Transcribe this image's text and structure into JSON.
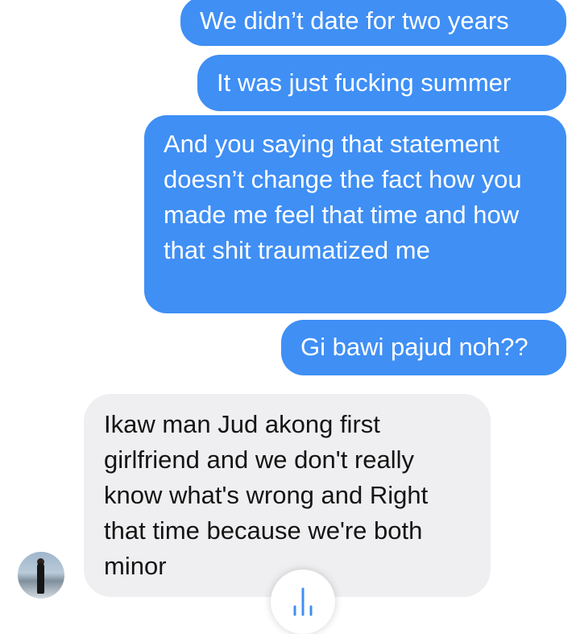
{
  "messages": [
    {
      "sender": "me",
      "text": "We didn’t date for two years"
    },
    {
      "sender": "me",
      "text": "It was just fucking summer"
    },
    {
      "sender": "me",
      "text": "And you saying that statement doesn’t change the fact how you made me feel that time and how that shit traumatized me"
    },
    {
      "sender": "me",
      "text": "Gi bawi pajud noh??"
    },
    {
      "sender": "them",
      "text": "Ikaw man Jud akong first girlfriend and we don't really know what's wrong and Right that time because we're both minor"
    }
  ],
  "colors": {
    "sent_bubble": "#3f8ff5",
    "received_bubble": "#efeff1",
    "background": "#ffffff"
  },
  "icons": {
    "scroll_down": "arrow-down-icon"
  }
}
